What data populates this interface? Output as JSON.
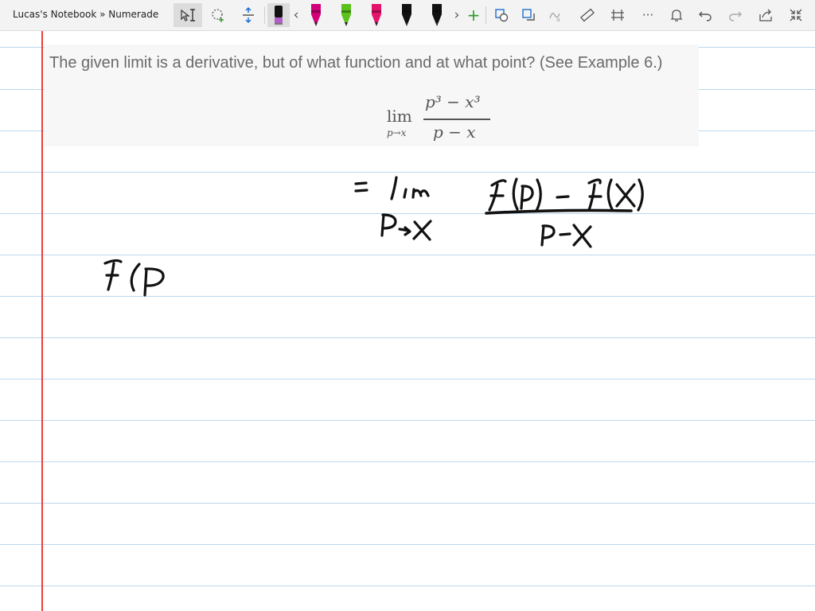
{
  "app": {
    "notebook_title": "Lucas's Notebook » Numerade"
  },
  "toolbar": {
    "items": [
      {
        "name": "lasso-select-icon",
        "glyph": "⬚"
      },
      {
        "name": "pen-black",
        "color": "#111111",
        "type": "pen"
      },
      {
        "name": "pen-magenta",
        "color": "#d1007a",
        "type": "pen"
      },
      {
        "name": "pen-green",
        "color": "#5ac21a",
        "type": "pen"
      },
      {
        "name": "pen-pink",
        "color": "#e5136c",
        "type": "pen"
      },
      {
        "name": "pen-black-2",
        "color": "#111111",
        "type": "pen"
      },
      {
        "name": "pen-black-3",
        "color": "#111111",
        "type": "pen"
      }
    ],
    "add_label": "+",
    "prev_label": "‹",
    "next_label": "›",
    "more_label": "···"
  },
  "problem": {
    "text": "The given limit is a derivative, but of what function and at what point? (See Example 6.)",
    "formula": {
      "lim": "lim",
      "lim_sub": "p→x",
      "numerator": "p³ − x³",
      "denominator": "p − x"
    }
  },
  "colors": {
    "margin": "#ee3d3d",
    "rule": "#bcd9ee",
    "ink": "#111111"
  }
}
